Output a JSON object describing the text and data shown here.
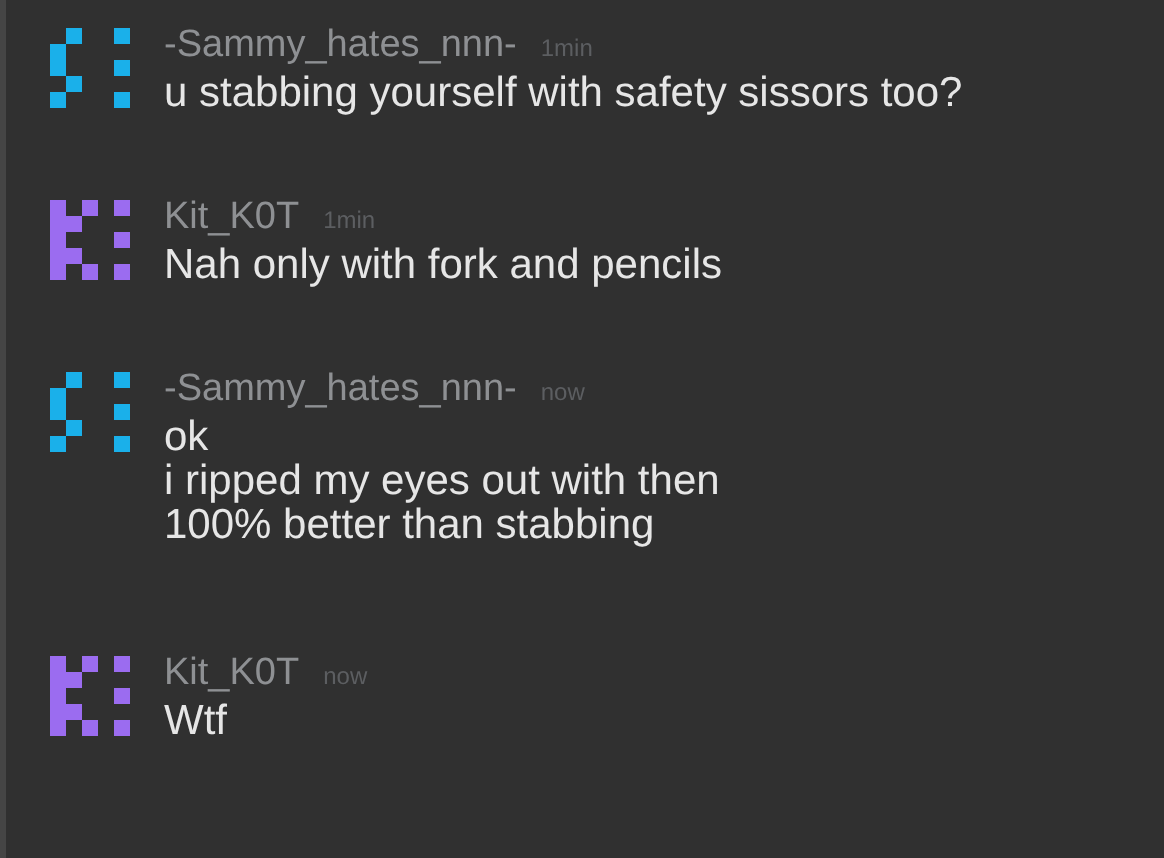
{
  "messages": [
    {
      "author": "-Sammy_hates_nnn-",
      "time": "1min",
      "kind": "a",
      "color": "#1ab0ea",
      "lines": [
        "u stabbing yourself with safety sissors too?"
      ]
    },
    {
      "author": "Kit_K0T",
      "time": "1min",
      "kind": "b",
      "color": "#9b6cf0",
      "lines": [
        "Nah only with fork and pencils"
      ]
    },
    {
      "author": "-Sammy_hates_nnn-",
      "time": "now",
      "kind": "a",
      "color": "#1ab0ea",
      "lines": [
        "ok",
        "i ripped my eyes out with then",
        "100% better than stabbing"
      ]
    },
    {
      "author": "Kit_K0T",
      "time": "now",
      "kind": "b",
      "color": "#9b6cf0",
      "lines": [
        "Wtf"
      ]
    }
  ]
}
